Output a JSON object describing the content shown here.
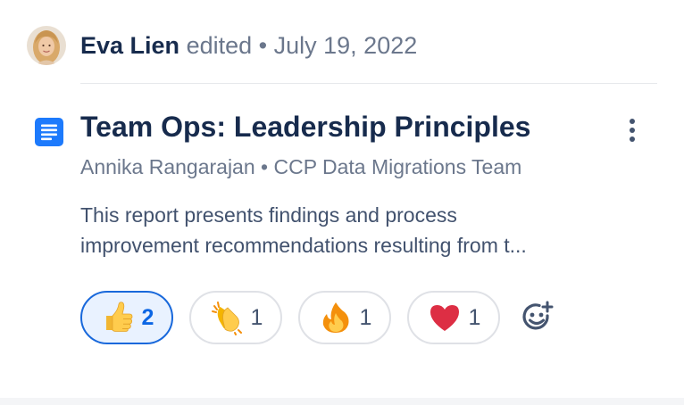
{
  "activity": {
    "author": "Eva Lien",
    "action": "edited",
    "separator": "•",
    "date": "July 19, 2022"
  },
  "document": {
    "title": "Team Ops: Leadership Principles",
    "owner": "Annika Rangarajan",
    "meta_separator": "•",
    "space": "CCP Data Migrations Team",
    "excerpt_line1": "This report presents findings and process",
    "excerpt_line2": "improvement recommendations resulting from t..."
  },
  "reactions": [
    {
      "emoji": "thumbs-up",
      "count": "2",
      "selected": true
    },
    {
      "emoji": "clapping-hands",
      "count": "1",
      "selected": false
    },
    {
      "emoji": "fire",
      "count": "1",
      "selected": false
    },
    {
      "emoji": "red-heart",
      "count": "1",
      "selected": false
    }
  ],
  "colors": {
    "selected_border": "#1868db",
    "selected_bg": "#e9f2ff",
    "title": "#172b4d",
    "meta": "#6b778c",
    "doc_icon": "#1d7afc"
  }
}
